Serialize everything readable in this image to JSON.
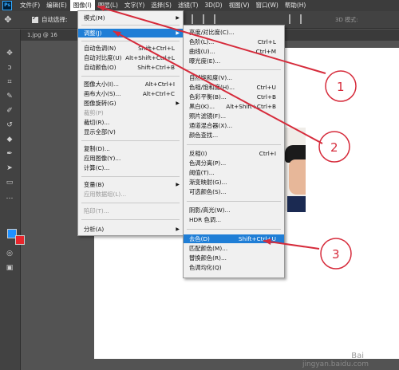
{
  "menubar": {
    "logo": "Ps",
    "items": [
      "文件(F)",
      "编辑(E)",
      "图像(I)",
      "图层(L)",
      "文字(Y)",
      "选择(S)",
      "滤镜(T)",
      "3D(D)",
      "视图(V)",
      "窗口(W)",
      "帮助(H)"
    ]
  },
  "options_bar": {
    "auto_select_label": "自动选择:",
    "mode_3d": "3D 模式:"
  },
  "document_tab": {
    "label": "1.jpg @ 16"
  },
  "image_menu": {
    "items": [
      {
        "label": "模式(M)",
        "shortcut": "",
        "submenu": true,
        "disabled": false
      },
      {
        "label": "调整(J)",
        "shortcut": "",
        "submenu": true,
        "disabled": false,
        "highlighted": true
      },
      {
        "label": "自动色调(N)",
        "shortcut": "Shift+Ctrl+L"
      },
      {
        "label": "自动对比度(U)",
        "shortcut": "Alt+Shift+Ctrl+L"
      },
      {
        "label": "自动颜色(O)",
        "shortcut": "Shift+Ctrl+B"
      },
      {
        "label": "图像大小(I)...",
        "shortcut": "Alt+Ctrl+I"
      },
      {
        "label": "画布大小(S)...",
        "shortcut": "Alt+Ctrl+C"
      },
      {
        "label": "图像旋转(G)",
        "submenu": true
      },
      {
        "label": "裁剪(P)",
        "disabled": true
      },
      {
        "label": "裁切(R)..."
      },
      {
        "label": "显示全部(V)"
      },
      {
        "label": "复制(D)..."
      },
      {
        "label": "应用图像(Y)..."
      },
      {
        "label": "计算(C)..."
      },
      {
        "label": "变量(B)",
        "submenu": true
      },
      {
        "label": "应用数据组(L)...",
        "disabled": true
      },
      {
        "label": "陷印(T)...",
        "disabled": true
      },
      {
        "label": "分析(A)",
        "submenu": true
      }
    ]
  },
  "adjust_menu": {
    "items": [
      {
        "label": "亮度/对比度(C)..."
      },
      {
        "label": "色阶(L)...",
        "shortcut": "Ctrl+L"
      },
      {
        "label": "曲线(U)...",
        "shortcut": "Ctrl+M"
      },
      {
        "label": "曝光度(E)..."
      },
      {
        "label": "自然饱和度(V)..."
      },
      {
        "label": "色相/饱和度(H)...",
        "shortcut": "Ctrl+U"
      },
      {
        "label": "色彩平衡(B)...",
        "shortcut": "Ctrl+B"
      },
      {
        "label": "黑白(K)...",
        "shortcut": "Alt+Shift+Ctrl+B"
      },
      {
        "label": "照片滤镜(F)..."
      },
      {
        "label": "通道混合器(X)..."
      },
      {
        "label": "颜色查找..."
      },
      {
        "label": "反相(I)",
        "shortcut": "Ctrl+I"
      },
      {
        "label": "色调分离(P)..."
      },
      {
        "label": "阈值(T)..."
      },
      {
        "label": "渐变映射(G)..."
      },
      {
        "label": "可选颜色(S)..."
      },
      {
        "label": "阴影/高光(W)..."
      },
      {
        "label": "HDR 色调..."
      },
      {
        "label": "去色(D)",
        "shortcut": "Shift+Ctrl+U",
        "highlighted": true
      },
      {
        "label": "匹配颜色(M)..."
      },
      {
        "label": "替换颜色(R)..."
      },
      {
        "label": "色调均化(Q)"
      }
    ]
  },
  "annotations": {
    "labels": [
      "1",
      "2",
      "3"
    ],
    "color": "#d62b3b"
  },
  "colors": {
    "foreground": "#1e90ff",
    "background": "#e8262c",
    "highlight": "#1f7ed6"
  },
  "watermark": {
    "line1": "Bai",
    "line2": "jingyan.baidu.com"
  }
}
